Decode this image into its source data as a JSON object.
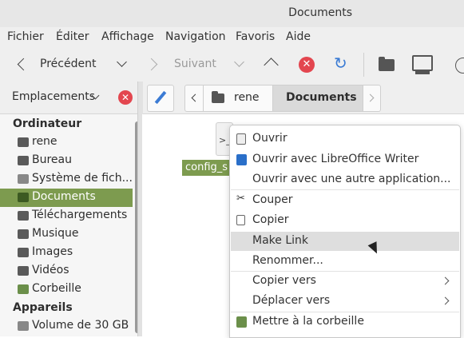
{
  "window": {
    "title": "Documents"
  },
  "menu": {
    "items": [
      "Fichier",
      "Éditer",
      "Affichage",
      "Navigation",
      "Favoris",
      "Aide"
    ]
  },
  "toolbar": {
    "back_label": "Précédent",
    "forward_label": "Suivant"
  },
  "sidebar": {
    "header_label": "Emplacements",
    "sections": [
      {
        "title": "Ordinateur",
        "items": [
          "rene",
          "Bureau",
          "Système de fich...",
          "Documents",
          "Téléchargements",
          "Musique",
          "Images",
          "Vidéos",
          "Corbeille"
        ]
      },
      {
        "title": "Appareils",
        "items": [
          "Volume de 30 GB"
        ]
      }
    ],
    "selected": "Documents"
  },
  "pathbar": {
    "segments": [
      "rene",
      "Documents"
    ]
  },
  "files": [
    {
      "name": "config_s",
      "icon_text": ">_"
    }
  ],
  "context_menu": {
    "items": [
      {
        "label": "Ouvrir",
        "icon": "file-icon"
      },
      {
        "label": "Ouvrir avec LibreOffice Writer",
        "icon": "writer-icon"
      },
      {
        "label": "Ouvrir avec une autre application..."
      },
      {
        "label": "Couper",
        "icon": "scissors-icon"
      },
      {
        "label": "Copier",
        "icon": "copy-icon"
      },
      {
        "label": "Make Link",
        "highlighted": true
      },
      {
        "label": "Renommer..."
      },
      {
        "label": "Copier vers",
        "submenu": true
      },
      {
        "label": "Déplacer vers",
        "submenu": true
      },
      {
        "label": "Mettre à la corbeille",
        "icon": "trash-icon"
      }
    ]
  },
  "colors": {
    "accent": "#7d9b4f",
    "danger": "#e3464f",
    "refresh": "#3b7bd4"
  }
}
